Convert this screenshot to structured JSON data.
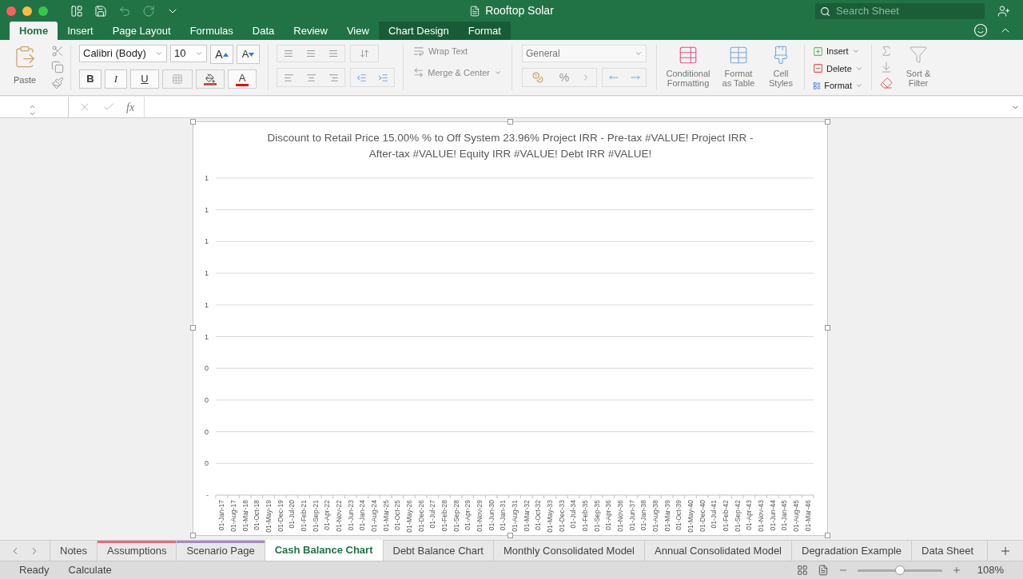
{
  "window": {
    "title": "Rooftop Solar"
  },
  "search": {
    "placeholder": "Search Sheet"
  },
  "ribbon_tabs": [
    {
      "label": "Home",
      "selected": true,
      "kind": "standard"
    },
    {
      "label": "Insert",
      "selected": false,
      "kind": "standard"
    },
    {
      "label": "Page Layout",
      "selected": false,
      "kind": "standard"
    },
    {
      "label": "Formulas",
      "selected": false,
      "kind": "standard"
    },
    {
      "label": "Data",
      "selected": false,
      "kind": "standard"
    },
    {
      "label": "Review",
      "selected": false,
      "kind": "standard"
    },
    {
      "label": "View",
      "selected": false,
      "kind": "standard"
    },
    {
      "label": "Chart Design",
      "selected": false,
      "kind": "contextual"
    },
    {
      "label": "Format",
      "selected": false,
      "kind": "contextual"
    }
  ],
  "ribbon": {
    "paste": "Paste",
    "font_name": "Calibri (Body)",
    "font_size": "10",
    "grow_font": "A",
    "shrink_font": "A",
    "bold": "B",
    "italic": "I",
    "underline": "U",
    "font_color": "A",
    "wrap_text": "Wrap Text",
    "merge_center": "Merge & Center",
    "number_format": "General",
    "percent": "%",
    "conditional_formatting": "Conditional Formatting",
    "format_as_table": "Format as Table",
    "cell_styles": "Cell Styles",
    "insert": "Insert",
    "delete": "Delete",
    "format": "Format",
    "sort_filter": "Sort & Filter"
  },
  "formula_bar": {
    "fx": "fx"
  },
  "chart": {
    "chart_data": {
      "type": "line",
      "grid": true,
      "title": "Discount to Retail Price 15.00% % to Off System 23.96% Project IRR - Pre-tax #VALUE! Project IRR - After-tax #VALUE! Equity IRR #VALUE! Debt IRR #VALUE!",
      "ylim": [
        0,
        1
      ],
      "yticks": [
        {
          "value": 1,
          "label": "1"
        },
        {
          "value": 0.9,
          "label": "1"
        },
        {
          "value": 0.8,
          "label": "1"
        },
        {
          "value": 0.7,
          "label": "1"
        },
        {
          "value": 0.6,
          "label": "1"
        },
        {
          "value": 0.5,
          "label": "1"
        },
        {
          "value": 0.4,
          "label": "0"
        },
        {
          "value": 0.3,
          "label": "0"
        },
        {
          "value": 0.2,
          "label": "0"
        },
        {
          "value": 0.1,
          "label": "0"
        },
        {
          "value": 0,
          "label": "-"
        }
      ],
      "categories": [
        "01-Jan-17",
        "01-Aug-17",
        "01-Mar-18",
        "01-Oct-18",
        "01-May-19",
        "01-Dec-19",
        "01-Jul-20",
        "01-Feb-21",
        "01-Sep-21",
        "01-Apr-22",
        "01-Nov-22",
        "01-Jun-23",
        "01-Jan-24",
        "01-Aug-24",
        "01-Mar-25",
        "01-Oct-25",
        "01-May-26",
        "01-Dec-26",
        "01-Jul-27",
        "01-Feb-28",
        "01-Sep-28",
        "01-Apr-29",
        "01-Nov-29",
        "01-Jun-30",
        "01-Jan-31",
        "01-Aug-31",
        "01-Mar-32",
        "01-Oct-32",
        "01-May-33",
        "01-Dec-33",
        "01-Jul-34",
        "01-Feb-35",
        "01-Sep-35",
        "01-Apr-36",
        "01-Nov-36",
        "01-Jun-37",
        "01-Jan-38",
        "01-Aug-38",
        "01-Mar-39",
        "01-Oct-39",
        "01-May-40",
        "01-Dec-40",
        "01-Jul-41",
        "01-Feb-42",
        "01-Sep-42",
        "01-Apr-43",
        "01-Nov-43",
        "01-Jun-44",
        "01-Jan-45",
        "01-Aug-45",
        "01-Mar-46"
      ]
    }
  },
  "sheet_tabs": [
    {
      "label": "Notes",
      "selected": false
    },
    {
      "label": "Assumptions",
      "selected": false,
      "color": "#e8697a"
    },
    {
      "label": "Scenario Page",
      "selected": false,
      "color": "#a98ac6"
    },
    {
      "label": "Cash Balance Chart",
      "selected": true
    },
    {
      "label": "Debt Balance Chart",
      "selected": false
    },
    {
      "label": "Monthly Consolidated Model",
      "selected": false
    },
    {
      "label": "Annual Consolidated Model",
      "selected": false
    },
    {
      "label": "Degradation Example",
      "selected": false
    },
    {
      "label": "Data Sheet",
      "selected": false
    }
  ],
  "status_bar": {
    "ready": "Ready",
    "calculate": "Calculate",
    "zoom": "108%",
    "zoom_slider": {
      "level": 0.5
    }
  }
}
